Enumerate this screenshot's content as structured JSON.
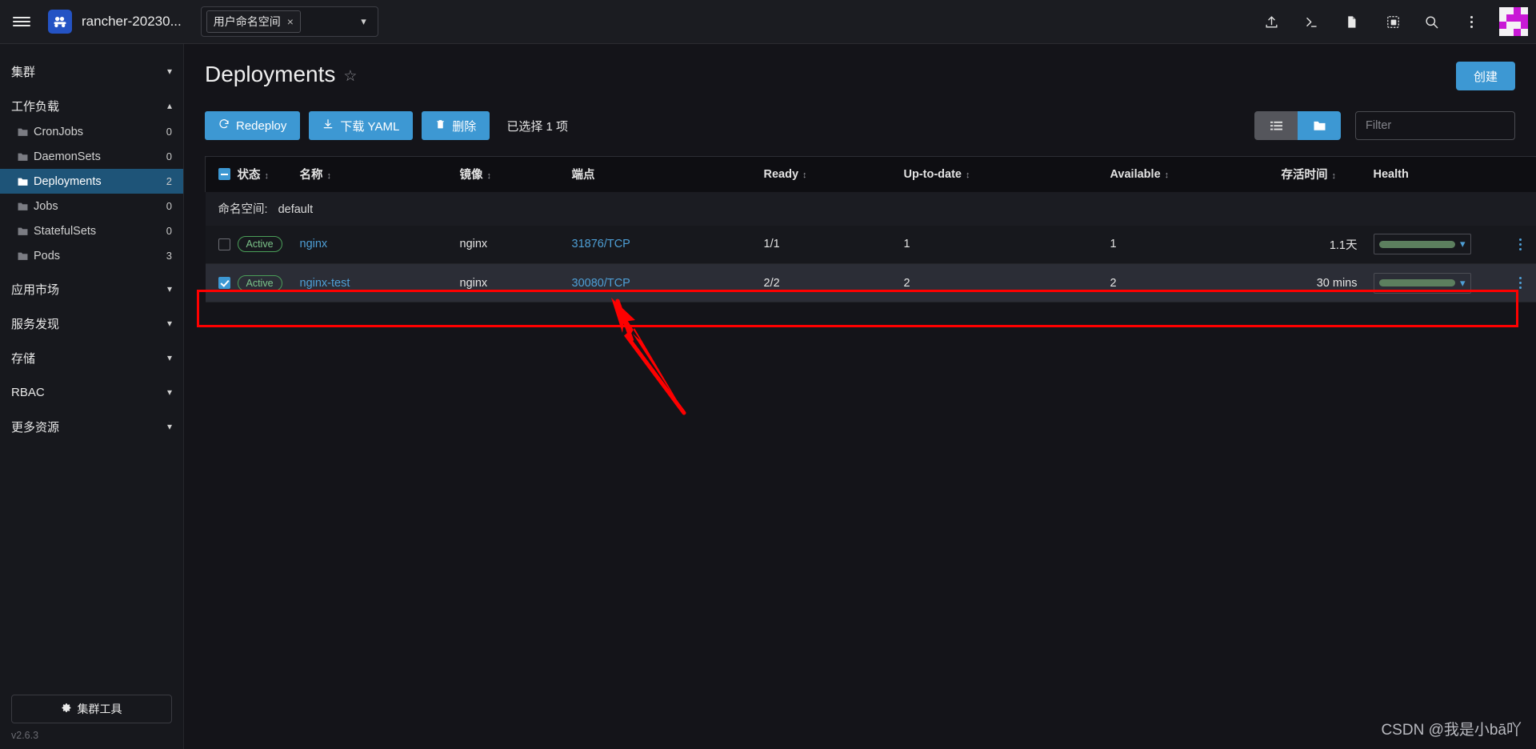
{
  "topbar": {
    "menu_icon": "hamburger-icon",
    "logo_icon": "rancher-logo-icon",
    "cluster_name": "rancher-20230...",
    "namespace_select": {
      "chip_label": "用户命名空间",
      "clear_label": "×",
      "caret": "chevron-down-icon"
    },
    "icons": [
      {
        "name": "upload-icon",
        "label": "导入 YAML"
      },
      {
        "name": "terminal-icon",
        "label": "Kubectl Shell"
      },
      {
        "name": "file-icon",
        "label": "Kubeconfig"
      },
      {
        "name": "copy-icon",
        "label": "复制"
      },
      {
        "name": "search-icon",
        "label": "搜索"
      },
      {
        "name": "kebab-menu-icon",
        "label": "更多"
      }
    ],
    "avatar_name": "user-avatar"
  },
  "sidebar": {
    "groups": [
      {
        "label": "集群",
        "expanded": false,
        "caret": "chevron-down-icon"
      },
      {
        "label": "工作负载",
        "expanded": true,
        "caret": "chevron-up-icon"
      }
    ],
    "workload_items": [
      {
        "label": "CronJobs",
        "count": "0",
        "active": false
      },
      {
        "label": "DaemonSets",
        "count": "0",
        "active": false
      },
      {
        "label": "Deployments",
        "count": "2",
        "active": true
      },
      {
        "label": "Jobs",
        "count": "0",
        "active": false
      },
      {
        "label": "StatefulSets",
        "count": "0",
        "active": false
      },
      {
        "label": "Pods",
        "count": "3",
        "active": false
      }
    ],
    "tail_groups": [
      {
        "label": "应用市场",
        "caret": "chevron-down-icon"
      },
      {
        "label": "服务发现",
        "caret": "chevron-down-icon"
      },
      {
        "label": "存储",
        "caret": "chevron-down-icon"
      },
      {
        "label": "RBAC",
        "caret": "chevron-down-icon"
      },
      {
        "label": "更多资源",
        "caret": "chevron-down-icon"
      }
    ],
    "cluster_tools": {
      "label": "集群工具",
      "icon": "gear-icon"
    },
    "version": "v2.6.3"
  },
  "main": {
    "page_title": "Deployments",
    "favorite_icon": "star-icon",
    "create_button": "创建",
    "toolbar": {
      "redeploy": {
        "label": "Redeploy",
        "icon": "refresh-icon"
      },
      "download_yaml": {
        "label": "下载 YAML",
        "icon": "download-icon"
      },
      "delete": {
        "label": "删除",
        "icon": "trash-icon"
      },
      "selected_text": "已选择 1 项",
      "view_list_icon": "list-view-icon",
      "view_group_icon": "folder-view-icon",
      "view_selected": "folder",
      "filter_placeholder": "Filter",
      "filter_value": ""
    },
    "table": {
      "columns": [
        {
          "label": "",
          "sortable": false,
          "key": "checkbox"
        },
        {
          "label": "状态",
          "sortable": true
        },
        {
          "label": "名称",
          "sortable": true
        },
        {
          "label": "镜像",
          "sortable": true
        },
        {
          "label": "端点",
          "sortable": false
        },
        {
          "label": "Ready",
          "sortable": true
        },
        {
          "label": "Up-to-date",
          "sortable": true
        },
        {
          "label": "Available",
          "sortable": true
        },
        {
          "label": "存活时间",
          "sortable": true
        },
        {
          "label": "Health",
          "sortable": false
        },
        {
          "label": "",
          "sortable": false,
          "key": "actions"
        }
      ],
      "group_label": "命名空间:",
      "group_value": "default",
      "rows": [
        {
          "checked": false,
          "state": "Active",
          "name": "nginx",
          "image": "nginx",
          "endpoint": "31876/TCP",
          "ready": "1/1",
          "uptodate": "1",
          "available": "1",
          "age": "1.1天",
          "health_color": "#5c7f5e",
          "highlighted": false
        },
        {
          "checked": true,
          "state": "Active",
          "name": "nginx-test",
          "image": "nginx",
          "endpoint": "30080/TCP",
          "ready": "2/2",
          "uptodate": "2",
          "available": "2",
          "age": "30 mins",
          "health_color": "#5c7f5e",
          "highlighted": true
        }
      ]
    }
  },
  "annotations": {
    "highlight_color": "#fe0000",
    "arrow_target": "30080/TCP endpoint of nginx-test row"
  },
  "watermark": "CSDN @我是小bā吖",
  "colors": {
    "accent": "#3d98d3",
    "link": "#4e9fd6",
    "active_nav": "#1e5478",
    "background": "#141419",
    "panel": "#17181d",
    "status_green": "#7cc48a",
    "annotation_red": "#fe0000"
  }
}
